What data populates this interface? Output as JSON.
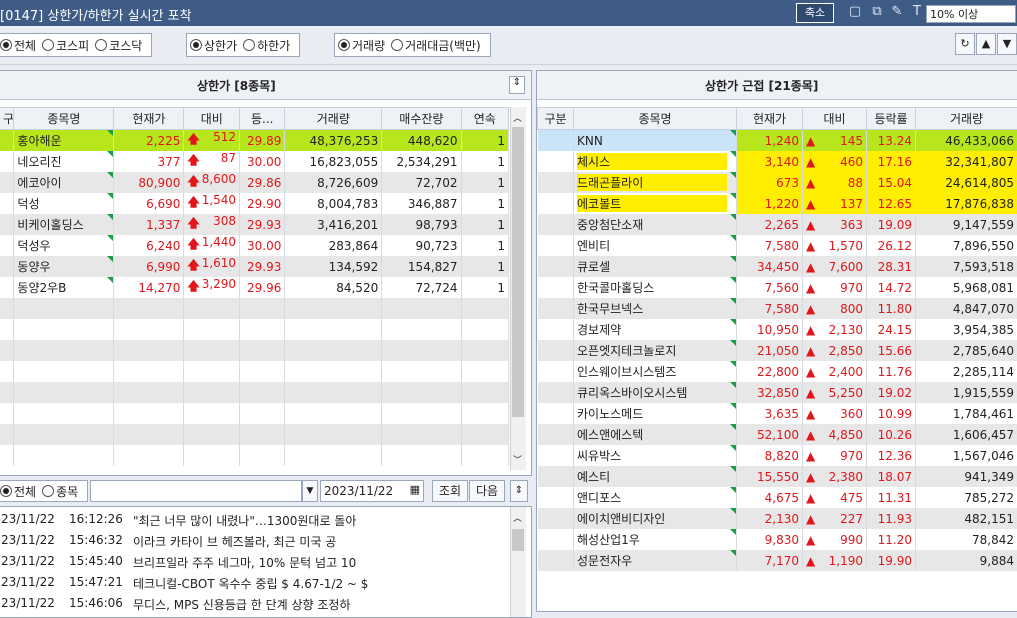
{
  "window": {
    "title": "[0147] 상한가/하한가 실시간 포착",
    "shrink_label": "축소",
    "icons": [
      "layout-icon",
      "window-icon",
      "pin-icon",
      "text-icon",
      "help-icon",
      "minimize-icon",
      "close-icon"
    ]
  },
  "toolbar": {
    "market_options": [
      "전체",
      "코스피",
      "코스닥"
    ],
    "market_selected": 0,
    "limit_options": [
      "상한가",
      "하한가"
    ],
    "limit_selected": 0,
    "volume_options": [
      "거래량",
      "거래대금(백만)"
    ],
    "volume_selected": 0
  },
  "left_panel": {
    "title": "상한가 [8종목]",
    "columns": [
      "구분",
      "종목명",
      "현재가",
      "대비",
      "등...",
      "거래량",
      "매수잔량",
      "연속"
    ],
    "rows": [
      {
        "name": "홍아해운",
        "price": "2,225",
        "change": "512",
        "rate": "29.89",
        "volume": "48,376,253",
        "bid": "448,620",
        "streak": "1"
      },
      {
        "name": "네오리진",
        "price": "377",
        "change": "87",
        "rate": "30.00",
        "volume": "16,823,055",
        "bid": "2,534,291",
        "streak": "1"
      },
      {
        "name": "에코아이",
        "price": "80,900",
        "change": "8,600",
        "rate": "29.86",
        "volume": "8,726,609",
        "bid": "72,702",
        "streak": "1"
      },
      {
        "name": "덕성",
        "price": "6,690",
        "change": "1,540",
        "rate": "29.90",
        "volume": "8,004,783",
        "bid": "346,887",
        "streak": "1"
      },
      {
        "name": "비케이홀딩스",
        "price": "1,337",
        "change": "308",
        "rate": "29.93",
        "volume": "3,416,201",
        "bid": "98,793",
        "streak": "1"
      },
      {
        "name": "덕성우",
        "price": "6,240",
        "change": "1,440",
        "rate": "30.00",
        "volume": "283,864",
        "bid": "90,723",
        "streak": "1"
      },
      {
        "name": "동양우",
        "price": "6,990",
        "change": "1,610",
        "rate": "29.93",
        "volume": "134,592",
        "bid": "154,827",
        "streak": "1"
      },
      {
        "name": "동양2우B",
        "price": "14,270",
        "change": "3,290",
        "rate": "29.96",
        "volume": "84,520",
        "bid": "72,724",
        "streak": "1"
      }
    ]
  },
  "news": {
    "filter_options": [
      "전체",
      "종목"
    ],
    "filter_selected": 0,
    "date": "2023/11/22",
    "search_label": "조회",
    "next_label": "다음",
    "items": [
      {
        "date": "23/11/22",
        "time": "16:12:26",
        "text": "\"최근 너무 많이 내렸나\"…1300원대로 돌아"
      },
      {
        "date": "23/11/22",
        "time": "15:46:32",
        "text": "이라크 카타이 브 헤즈볼라, 최근 미국 공"
      },
      {
        "date": "23/11/22",
        "time": "15:45:40",
        "text": "브리프일라 주주 네그마, 10% 문턱 넘고 10"
      },
      {
        "date": "23/11/22",
        "time": "15:47:21",
        "text": "테크니컬-CBOT 옥수수 중립 $ 4.67-1/2 ~ $"
      },
      {
        "date": "23/11/22",
        "time": "15:46:06",
        "text": "무디스, MPS 신용등급 한 단계 상향 조정하"
      }
    ]
  },
  "right_panel": {
    "title": "상한가 근접 [21종목]",
    "threshold": "10% 이상",
    "columns": [
      "구분",
      "종목명",
      "현재가",
      "대비",
      "등락률",
      "거래량"
    ],
    "rows": [
      {
        "name": "KNN",
        "price": "1,240",
        "change": "145",
        "rate": "13.24",
        "volume": "46,433,066",
        "hl": "blue"
      },
      {
        "name": "체시스",
        "price": "3,140",
        "change": "460",
        "rate": "17.16",
        "volume": "32,341,807",
        "hl": "yellow"
      },
      {
        "name": "드래곤플라이",
        "price": "673",
        "change": "88",
        "rate": "15.04",
        "volume": "24,614,805",
        "hl": "yellow"
      },
      {
        "name": "에코볼트",
        "price": "1,220",
        "change": "137",
        "rate": "12.65",
        "volume": "17,876,838",
        "hl": "yellow"
      },
      {
        "name": "중앙첨단소재",
        "price": "2,265",
        "change": "363",
        "rate": "19.09",
        "volume": "9,147,559",
        "hl": ""
      },
      {
        "name": "엔비티",
        "price": "7,580",
        "change": "1,570",
        "rate": "26.12",
        "volume": "7,896,550",
        "hl": ""
      },
      {
        "name": "큐로셀",
        "price": "34,450",
        "change": "7,600",
        "rate": "28.31",
        "volume": "7,593,518",
        "hl": ""
      },
      {
        "name": "한국콜마홀딩스",
        "price": "7,560",
        "change": "970",
        "rate": "14.72",
        "volume": "5,968,081",
        "hl": ""
      },
      {
        "name": "한국무브넥스",
        "price": "7,580",
        "change": "800",
        "rate": "11.80",
        "volume": "4,847,070",
        "hl": ""
      },
      {
        "name": "경보제약",
        "price": "10,950",
        "change": "2,130",
        "rate": "24.15",
        "volume": "3,954,385",
        "hl": ""
      },
      {
        "name": "오픈엣지테크놀로지",
        "price": "21,050",
        "change": "2,850",
        "rate": "15.66",
        "volume": "2,785,640",
        "hl": ""
      },
      {
        "name": "인스웨이브시스템즈",
        "price": "22,800",
        "change": "2,400",
        "rate": "11.76",
        "volume": "2,285,114",
        "hl": ""
      },
      {
        "name": "큐리옥스바이오시스템",
        "price": "32,850",
        "change": "5,250",
        "rate": "19.02",
        "volume": "1,915,559",
        "hl": ""
      },
      {
        "name": "카이노스메드",
        "price": "3,635",
        "change": "360",
        "rate": "10.99",
        "volume": "1,784,461",
        "hl": ""
      },
      {
        "name": "에스앤에스텍",
        "price": "52,100",
        "change": "4,850",
        "rate": "10.26",
        "volume": "1,606,457",
        "hl": ""
      },
      {
        "name": "씨유박스",
        "price": "8,820",
        "change": "970",
        "rate": "12.36",
        "volume": "1,567,046",
        "hl": ""
      },
      {
        "name": "예스티",
        "price": "15,550",
        "change": "2,380",
        "rate": "18.07",
        "volume": "941,349",
        "hl": ""
      },
      {
        "name": "앤디포스",
        "price": "4,675",
        "change": "475",
        "rate": "11.31",
        "volume": "785,272",
        "hl": ""
      },
      {
        "name": "에이치앤비디자인",
        "price": "2,130",
        "change": "227",
        "rate": "11.93",
        "volume": "482,151",
        "hl": ""
      },
      {
        "name": "해성산업1우",
        "price": "9,830",
        "change": "990",
        "rate": "11.20",
        "volume": "78,842",
        "hl": ""
      },
      {
        "name": "성문전자우",
        "price": "7,170",
        "change": "1,190",
        "rate": "19.90",
        "volume": "9,884",
        "hl": ""
      }
    ]
  },
  "colors": {
    "title_bar": "#3f5c86",
    "up_red": "#e0161b",
    "highlight_green": "#b7e61c",
    "highlight_yellow": "#ffee00",
    "highlight_blue": "#c9e4f7"
  }
}
